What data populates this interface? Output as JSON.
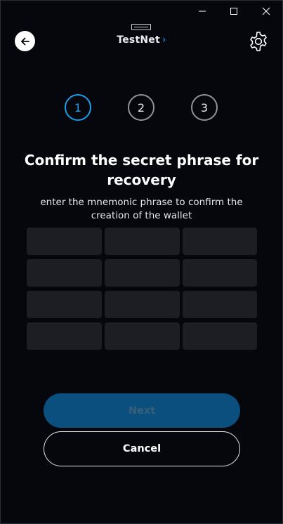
{
  "header": {
    "network_label": "TestNet",
    "network_chevron": "›",
    "back_icon": "arrow-left-icon",
    "settings_icon": "gear-icon"
  },
  "window_controls": [
    "minimize-icon",
    "maximize-icon",
    "close-icon"
  ],
  "steps": [
    {
      "label": "1",
      "active": true
    },
    {
      "label": "2",
      "active": false
    },
    {
      "label": "3",
      "active": false
    }
  ],
  "content": {
    "title": "Confirm the secret phrase for recovery",
    "subtitle": "enter the mnemonic phrase to confirm the creation of the wallet"
  },
  "phrase_fields": [
    "",
    "",
    "",
    "",
    "",
    "",
    "",
    "",
    "",
    "",
    "",
    ""
  ],
  "buttons": {
    "next_label": "Next",
    "cancel_label": "Cancel"
  },
  "colors": {
    "background": "#05070d",
    "accent": "#1e9bea",
    "next_button_bg": "#0a4f7d",
    "field_bg": "#1c1e23"
  }
}
